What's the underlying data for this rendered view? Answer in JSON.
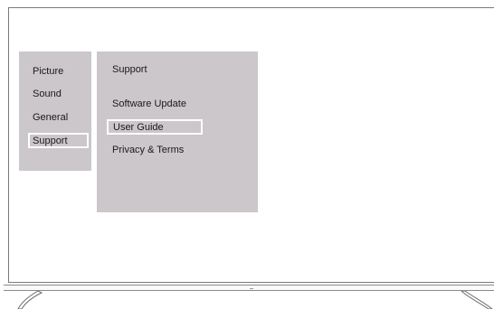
{
  "side_menu": {
    "items": [
      {
        "label": "Picture"
      },
      {
        "label": "Sound"
      },
      {
        "label": "General"
      },
      {
        "label": "Support",
        "selected": true
      }
    ]
  },
  "submenu": {
    "title": "Support",
    "items": [
      {
        "label": "Software Update"
      },
      {
        "label": "User Guide",
        "selected": true
      },
      {
        "label": "Privacy & Terms"
      }
    ]
  },
  "icons": [
    "stand-left-icon",
    "stand-right-icon"
  ],
  "colors": {
    "panel": "#cbc7cb",
    "highlight_border": "#ffffff",
    "text": "#1a1a1a"
  }
}
